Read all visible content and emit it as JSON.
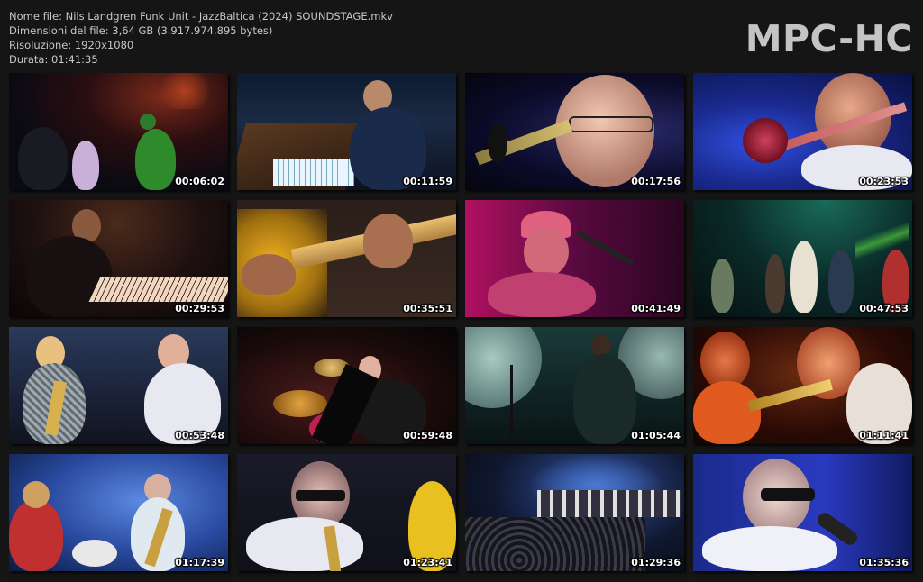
{
  "file_info": {
    "name_line": "Nome file: Nils Landgren Funk Unit - JazzBaltica (2024) SOUNDSTAGE.mkv",
    "size_line": "Dimensioni del file: 3,64 GB (3.917.974.895 bytes)",
    "resolution_line": "Risoluzione: 1920x1080",
    "duration_line": "Durata: 01:41:35"
  },
  "logo": "MPC-HC",
  "thumbnails": [
    {
      "timestamp": "00:06:02"
    },
    {
      "timestamp": "00:11:59"
    },
    {
      "timestamp": "00:17:56"
    },
    {
      "timestamp": "00:23:53"
    },
    {
      "timestamp": "00:29:53"
    },
    {
      "timestamp": "00:35:51"
    },
    {
      "timestamp": "00:41:49"
    },
    {
      "timestamp": "00:47:53"
    },
    {
      "timestamp": "00:53:48"
    },
    {
      "timestamp": "00:59:48"
    },
    {
      "timestamp": "01:05:44"
    },
    {
      "timestamp": "01:11:41"
    },
    {
      "timestamp": "01:17:39"
    },
    {
      "timestamp": "01:23:41"
    },
    {
      "timestamp": "01:29:36"
    },
    {
      "timestamp": "01:35:36"
    }
  ]
}
